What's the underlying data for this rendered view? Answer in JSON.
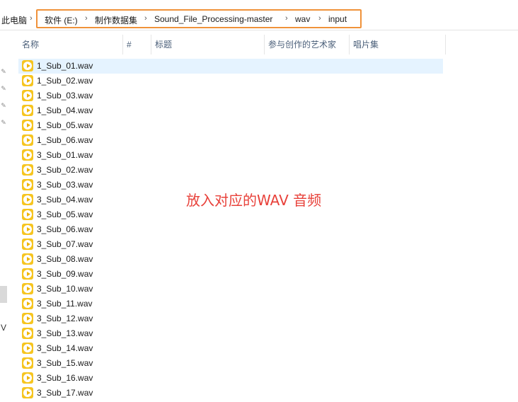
{
  "address_bar": {
    "root": "此电脑",
    "crumbs": [
      "软件 (E:)",
      "制作数据集",
      "Sound_File_Processing-master",
      "wav",
      "input"
    ],
    "separator": "›"
  },
  "columns": [
    "名称",
    "#",
    "标题",
    "参与创作的艺术家",
    "唱片集"
  ],
  "files": [
    "1_Sub_01.wav",
    "1_Sub_02.wav",
    "1_Sub_03.wav",
    "1_Sub_04.wav",
    "1_Sub_05.wav",
    "1_Sub_06.wav",
    "3_Sub_01.wav",
    "3_Sub_02.wav",
    "3_Sub_03.wav",
    "3_Sub_04.wav",
    "3_Sub_05.wav",
    "3_Sub_06.wav",
    "3_Sub_07.wav",
    "3_Sub_08.wav",
    "3_Sub_09.wav",
    "3_Sub_10.wav",
    "3_Sub_11.wav",
    "3_Sub_12.wav",
    "3_Sub_13.wav",
    "3_Sub_14.wav",
    "3_Sub_15.wav",
    "3_Sub_16.wav",
    "3_Sub_17.wav"
  ],
  "selected_index": 0,
  "annotation": "放入对应的WAV 音频",
  "nav_partial_text": "V",
  "colors": {
    "highlight_box": "#f0923a",
    "annotation": "#e8413a",
    "selected_row": "#e5f3ff",
    "file_icon": "#f6c520"
  },
  "icons": {
    "file": "audio-file-icon",
    "pin": "pin-icon"
  }
}
